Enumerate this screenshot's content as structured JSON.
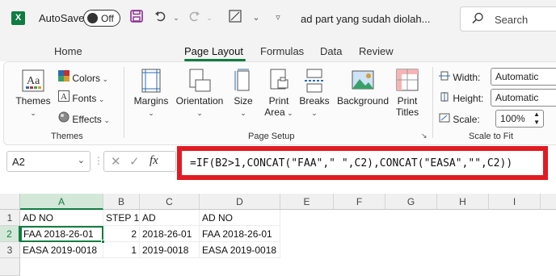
{
  "titlebar": {
    "app_logo": "X",
    "autosave_label": "AutoSave",
    "autosave_state": "Off",
    "doc_title": "ad part yang sudah diolah...",
    "search_placeholder": "Search",
    "icons": [
      "save-icon",
      "undo-icon",
      "redo-icon",
      "customize-qat-icon",
      "search-icon"
    ]
  },
  "tabs": {
    "items": [
      "Home",
      "Page Layout",
      "Formulas",
      "Data",
      "Review"
    ],
    "active": "Page Layout",
    "accent": "#107c41"
  },
  "ribbon": {
    "themes_group": {
      "themes": "Themes",
      "colors": "Colors",
      "fonts": "Fonts",
      "effects": "Effects",
      "label": "Themes"
    },
    "page_setup_group": {
      "margins": "Margins",
      "orientation": "Orientation",
      "size": "Size",
      "print_area_1": "Print",
      "print_area_2": "Area",
      "breaks": "Breaks",
      "background": "Background",
      "print_titles_1": "Print",
      "print_titles_2": "Titles",
      "label": "Page Setup"
    },
    "scale_group": {
      "width_label": "Width:",
      "width_value": "Automatic",
      "height_label": "Height:",
      "height_value": "Automatic",
      "scale_label": "Scale:",
      "scale_value": "100%",
      "label": "Scale to Fit"
    }
  },
  "formula_bar": {
    "name_box": "A2",
    "fx": "fx",
    "formula": "=IF(B2>1,CONCAT(\"FAA\",\" \",C2),CONCAT(\"EASA\",\"\",C2))",
    "highlight_color": "#e11b22"
  },
  "sheet": {
    "columns": [
      "A",
      "B",
      "C",
      "D",
      "E",
      "F",
      "G",
      "H",
      "I"
    ],
    "selected_column": "A",
    "rows": [
      {
        "num": "1",
        "cells": [
          "AD NO",
          "STEP 1",
          "AD",
          "AD NO"
        ]
      },
      {
        "num": "2",
        "cells": [
          "FAA 2018-26-01",
          "2",
          "2018-26-01",
          "FAA 2018-26-01"
        ]
      },
      {
        "num": "3",
        "cells": [
          "EASA 2019-0018",
          "1",
          "2019-0018",
          "EASA 2019-0018"
        ]
      }
    ],
    "selected_row": "2",
    "active_cell": "A2"
  }
}
